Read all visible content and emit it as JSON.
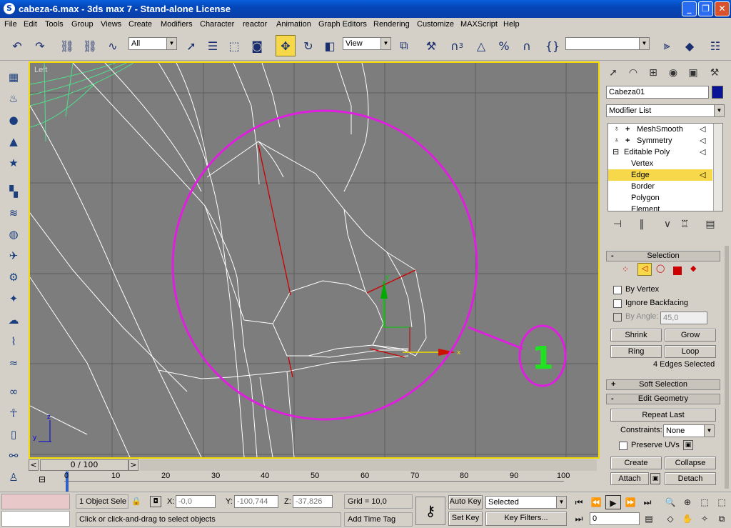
{
  "window": {
    "title": "cabeza-6.max - 3ds max 7 - Stand-alone License",
    "minimize_glyph": "_",
    "maximize_glyph": "❐",
    "close_glyph": "✕"
  },
  "menu": [
    "File",
    "Edit",
    "Tools",
    "Group",
    "Views",
    "Create",
    "Modifiers",
    "Character",
    "reactor",
    "Animation",
    "Graph Editors",
    "Rendering",
    "Customize",
    "MAXScript",
    "Help"
  ],
  "toolbar": {
    "selection_filter": "All",
    "reference_coord": "View",
    "named_selection": "",
    "snap_3_label": "3"
  },
  "viewport": {
    "label": "Left",
    "annotation_number": "1",
    "axis_x": "x",
    "axis_y": "y",
    "gizmo_x": "x",
    "gizmo_y": "y",
    "corner_z": "z",
    "corner_y": "y",
    "colors": {
      "background": "#7d7d7d",
      "grid": "#5f5f5f",
      "wire": "#ffffff",
      "selected_edge": "#cc0000",
      "annotation": "#e01ee0",
      "annotation_text": "#22e022",
      "green_mesh": "#4fe08c"
    }
  },
  "command_panel": {
    "object_name": "Cabeza01",
    "modifier_list": "Modifier List",
    "stack": [
      {
        "label": "MeshSmooth",
        "prefix": "+"
      },
      {
        "label": "Symmetry",
        "prefix": "+"
      },
      {
        "label": "Editable Poly",
        "prefix": "⊟"
      },
      {
        "label": "Vertex"
      },
      {
        "label": "Edge",
        "selected": true
      },
      {
        "label": "Border"
      },
      {
        "label": "Polygon"
      },
      {
        "label": "Element"
      }
    ],
    "selection": {
      "title": "Selection",
      "by_vertex": "By Vertex",
      "ignore_backfacing": "Ignore Backfacing",
      "by_angle": "By Angle:",
      "angle_value": "45,0",
      "shrink": "Shrink",
      "grow": "Grow",
      "ring": "Ring",
      "loop": "Loop",
      "status": "4 Edges Selected"
    },
    "soft_selection": "Soft Selection",
    "edit_geometry": {
      "title": "Edit Geometry",
      "repeat_last": "Repeat Last",
      "constraints_label": "Constraints:",
      "constraints_value": "None",
      "preserve_uvs": "Preserve UVs",
      "create": "Create",
      "collapse": "Collapse",
      "attach": "Attach",
      "detach": "Detach"
    },
    "rollout_minus": "-",
    "rollout_plus": "+"
  },
  "timeline": {
    "frame_display": "0 / 100",
    "prev": "<",
    "next": ">",
    "ticks": [
      "0",
      "10",
      "20",
      "30",
      "40",
      "50",
      "60",
      "70",
      "80",
      "90",
      "100"
    ]
  },
  "status": {
    "selection_count": "1 Object Sele",
    "x_label": "X:",
    "x_value": "-0,0",
    "y_label": "Y:",
    "y_value": "-100,744",
    "z_label": "Z:",
    "z_value": "-37,826",
    "grid": "Grid = 10,0",
    "prompt": "Click or click-and-drag to select objects",
    "add_time_tag": "Add Time Tag",
    "auto_key": "Auto Key",
    "set_key": "Set Key",
    "key_mode": "Selected",
    "key_filters": "Key Filters...",
    "current_frame": "0"
  }
}
